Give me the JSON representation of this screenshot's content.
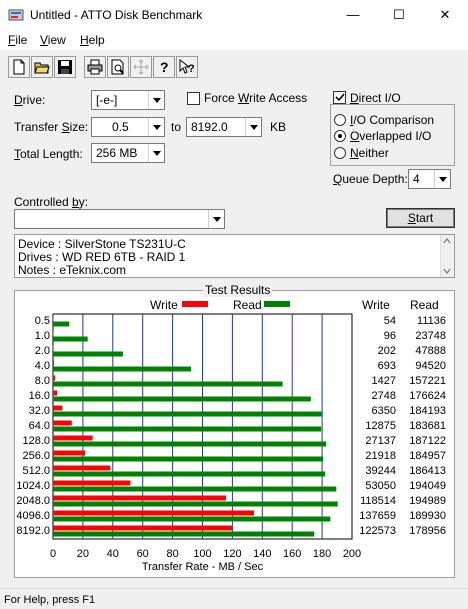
{
  "window": {
    "title": "Untitled - ATTO Disk Benchmark",
    "minimize": "—",
    "maximize": "☐",
    "close": "✕"
  },
  "menu": {
    "file": "File",
    "view": "View",
    "help": "Help"
  },
  "toolbar": {
    "icons": [
      "new-file-icon",
      "open-folder-icon",
      "save-icon",
      "print-icon",
      "print-preview-icon",
      "move-icon",
      "help-icon",
      "context-help-icon"
    ]
  },
  "form": {
    "drive_label": "Drive:",
    "drive_value": "[-e-]",
    "transfer_size_label": "Transfer Size:",
    "transfer_from": "0.5",
    "to_label": "to",
    "transfer_to": "8192.0",
    "kb_label": "KB",
    "total_length_label": "Total Length:",
    "total_length_value": "256 MB",
    "force_write_label": "Force Write Access",
    "force_write_checked": false,
    "direct_io_label": "Direct I/O",
    "direct_io_checked": true,
    "io_comparison_label": "I/O Comparison",
    "overlapped_io_label": "Overlapped I/O",
    "neither_label": "Neither",
    "io_mode_selected": "overlapped",
    "queue_depth_label": "Queue Depth:",
    "queue_depth_value": "4",
    "controlled_by_label": "Controlled by:",
    "controlled_by_value": "",
    "start_label": "Start"
  },
  "notes": {
    "line1": "Device : SilverStone TS231U-C",
    "line2": "Drives : WD RED 6TB - RAID 1",
    "line3": "Notes : eTeknix.com"
  },
  "results": {
    "group_title": "Test Results",
    "legend_write": "Write",
    "legend_read": "Read",
    "col_write": "Write",
    "col_read": "Read",
    "write_color": "#ff0000",
    "read_color": "#008000",
    "rows": [
      {
        "size": "0.5",
        "write": "54",
        "read": "11136"
      },
      {
        "size": "1.0",
        "write": "96",
        "read": "23748"
      },
      {
        "size": "2.0",
        "write": "202",
        "read": "47888"
      },
      {
        "size": "4.0",
        "write": "693",
        "read": "94520"
      },
      {
        "size": "8.0",
        "write": "1427",
        "read": "157221"
      },
      {
        "size": "16.0",
        "write": "2748",
        "read": "176624"
      },
      {
        "size": "32.0",
        "write": "6350",
        "read": "184193"
      },
      {
        "size": "64.0",
        "write": "12875",
        "read": "183681"
      },
      {
        "size": "128.0",
        "write": "27137",
        "read": "187122"
      },
      {
        "size": "256.0",
        "write": "21918",
        "read": "184957"
      },
      {
        "size": "512.0",
        "write": "39244",
        "read": "186413"
      },
      {
        "size": "1024.0",
        "write": "53050",
        "read": "194049"
      },
      {
        "size": "2048.0",
        "write": "118514",
        "read": "194989"
      },
      {
        "size": "4096.0",
        "write": "137659",
        "read": "189930"
      },
      {
        "size": "8192.0",
        "write": "122573",
        "read": "178956"
      }
    ]
  },
  "chart_data": {
    "type": "bar",
    "orientation": "horizontal",
    "categories": [
      "0.5",
      "1.0",
      "2.0",
      "4.0",
      "8.0",
      "16.0",
      "32.0",
      "64.0",
      "128.0",
      "256.0",
      "512.0",
      "1024.0",
      "2048.0",
      "4096.0",
      "8192.0"
    ],
    "series": [
      {
        "name": "Write",
        "values": [
          0.05,
          0.09,
          0.2,
          0.68,
          1.39,
          2.68,
          6.2,
          12.57,
          26.5,
          21.4,
          38.32,
          51.81,
          115.74,
          134.43,
          119.7
        ]
      },
      {
        "name": "Read",
        "values": [
          10.88,
          23.19,
          46.77,
          92.3,
          153.54,
          172.48,
          179.88,
          179.38,
          182.74,
          180.62,
          182.04,
          189.5,
          190.42,
          185.48,
          174.76
        ]
      }
    ],
    "xlabel": "Transfer Rate - MB / Sec",
    "xticks": [
      "0",
      "20",
      "40",
      "60",
      "80",
      "100",
      "120",
      "140",
      "160",
      "180",
      "200"
    ],
    "xlim": [
      0,
      200
    ],
    "grid": true,
    "legend": "top"
  },
  "status": {
    "text": "For Help, press F1"
  }
}
